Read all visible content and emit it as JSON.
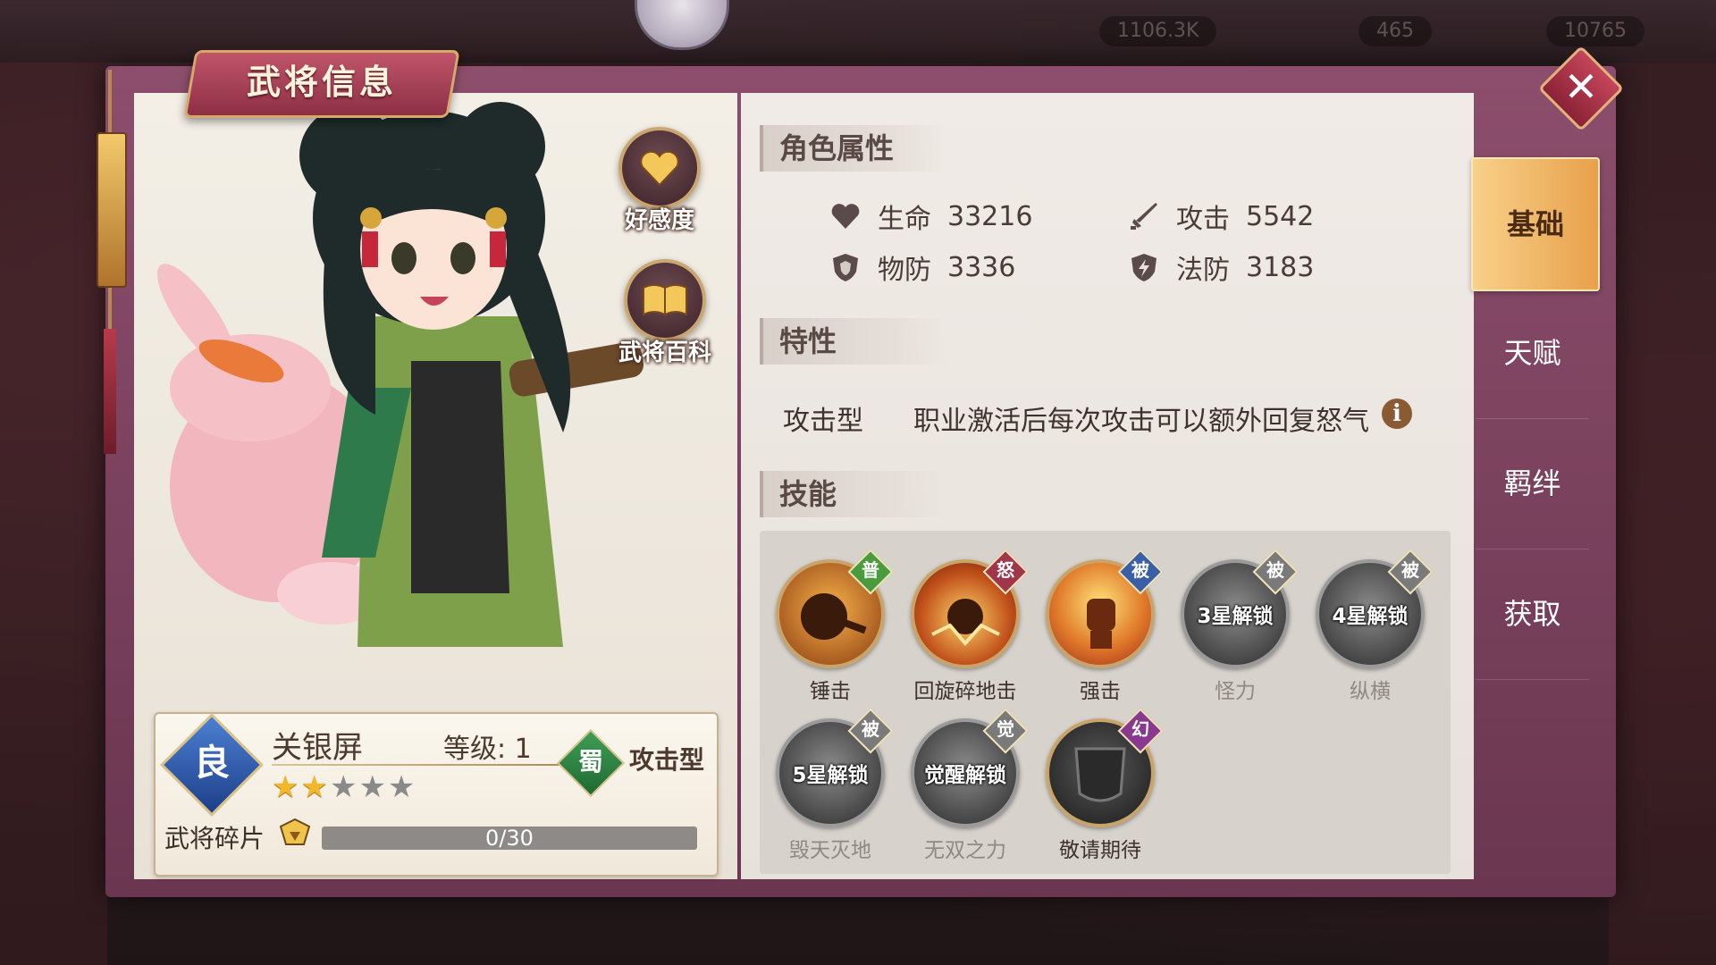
{
  "topbar": {
    "resource_1": "1106.3K",
    "resource_2": "465",
    "resource_3": "10765"
  },
  "window": {
    "title": "武将信息",
    "close_symbol": "✕"
  },
  "side_buttons": {
    "affinity_label": "好感度",
    "encyclopedia_label": "武将百科"
  },
  "hero": {
    "rank": "良",
    "name": "关银屏",
    "level_text": "等级: 1",
    "stars_filled": 2,
    "stars_total": 5,
    "star_on": "★★",
    "star_off": "★★★",
    "faction": "蜀",
    "type": "攻击型",
    "shard_label": "武将碎片",
    "shard_progress": "0/30",
    "shard_fraction": 0
  },
  "sections": {
    "attributes": "角色属性",
    "traits": "特性",
    "skills": "技能"
  },
  "attributes": {
    "hp": {
      "name": "生命",
      "value": "33216"
    },
    "atk": {
      "name": "攻击",
      "value": "5542"
    },
    "pdef": {
      "name": "物防",
      "value": "3336"
    },
    "mdef": {
      "name": "法防",
      "value": "3183"
    }
  },
  "trait": {
    "type": "攻击型",
    "description": "职业激活后每次攻击可以额外回复怒气",
    "info_symbol": "i"
  },
  "skills": [
    {
      "name": "锤击",
      "tag": "普",
      "tag_color": "#4a9a3e",
      "locked": false
    },
    {
      "name": "回旋碎地击",
      "tag": "怒",
      "tag_color": "#a0364a",
      "locked": false
    },
    {
      "name": "强击",
      "tag": "被",
      "tag_color": "#3a5fa6",
      "locked": false
    },
    {
      "name": "怪力",
      "tag": "被",
      "tag_color": "#7a7a7a",
      "locked": true,
      "lock_text": "3星解锁"
    },
    {
      "name": "纵横",
      "tag": "被",
      "tag_color": "#7a7a7a",
      "locked": true,
      "lock_text": "4星解锁"
    },
    {
      "name": "毁天灭地",
      "tag": "被",
      "tag_color": "#7a7a7a",
      "locked": true,
      "lock_text": "5星解锁"
    },
    {
      "name": "无双之力",
      "tag": "觉",
      "tag_color": "#7a7a7a",
      "locked": true,
      "lock_text": "觉醒解锁"
    },
    {
      "name": "敬请期待",
      "tag": "幻",
      "tag_color": "#8a3a8e",
      "locked": false
    }
  ],
  "tabs": [
    "基础",
    "天赋",
    "羁绊",
    "获取"
  ],
  "colors": {
    "accent": "#e8a14b",
    "frame": "#7a3f5c"
  }
}
